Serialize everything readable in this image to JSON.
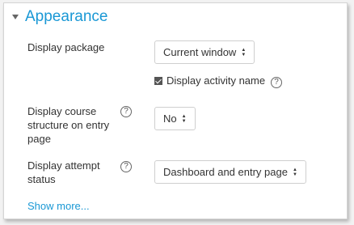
{
  "section": {
    "title": "Appearance"
  },
  "fields": {
    "display_package": {
      "label": "Display package",
      "value": "Current window"
    },
    "display_activity_name": {
      "label": "Display activity name",
      "checked": true
    },
    "display_course_structure": {
      "label": "Display course structure on entry page",
      "value": "No"
    },
    "display_attempt_status": {
      "label": "Display attempt status",
      "value": "Dashboard and entry page"
    }
  },
  "help_glyph": "?",
  "select_arrow_up": "▲",
  "select_arrow_down": "▼",
  "show_more": "Show more...",
  "colors": {
    "accent": "#1a98d5",
    "text": "#333333"
  }
}
